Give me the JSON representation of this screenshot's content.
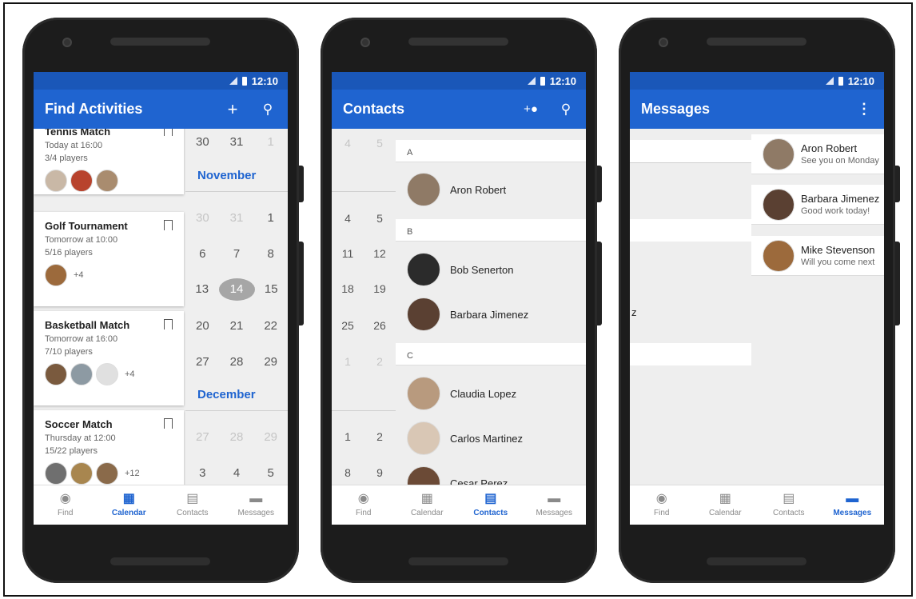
{
  "status": {
    "time": "12:10"
  },
  "nav": [
    "Find",
    "Calendar",
    "Contacts",
    "Messages"
  ],
  "icons": {
    "find": "compass-icon",
    "calendar": "calendar-icon",
    "contacts": "contacts-icon",
    "messages": "message-icon"
  },
  "colors": {
    "primary": "#1f64d0",
    "status": "#1a57b8"
  },
  "find": {
    "title": "Find Activities",
    "cards": [
      {
        "title": "Tennis Match",
        "time": "Today at 16:00",
        "players": "3/4 players",
        "more": ""
      },
      {
        "title": "Golf Tournament",
        "time": "Tomorrow at 10:00",
        "players": "5/16 players",
        "more": "+4"
      },
      {
        "title": "Basketball Match",
        "time": "Tomorrow at 16:00",
        "players": "7/10 players",
        "more": "+4"
      },
      {
        "title": "Soccer Match",
        "time": "Thursday at 12:00",
        "players": "15/22 players",
        "more": "+12"
      }
    ],
    "calendar": {
      "rows": [
        [
          "30",
          "31",
          "1"
        ],
        [
          "30",
          "31",
          "1"
        ],
        [
          "6",
          "7",
          "8"
        ],
        [
          "13",
          "14",
          "15"
        ],
        [
          "20",
          "21",
          "22"
        ],
        [
          "27",
          "28",
          "29"
        ],
        [
          "27",
          "28",
          "29"
        ],
        [
          "3",
          "4",
          "5"
        ]
      ],
      "months": [
        "November",
        "December"
      ]
    }
  },
  "contacts": {
    "title": "Contacts",
    "sections": [
      "A",
      "B",
      "C"
    ],
    "people": [
      "Aron Robert",
      "Bob Senerton",
      "Barbara Jimenez",
      "Claudia Lopez",
      "Carlos Martinez",
      "Cesar Perez"
    ],
    "left": [
      [
        "4",
        "5"
      ],
      [
        "4",
        "5"
      ],
      [
        "11",
        "12"
      ],
      [
        "18",
        "19"
      ],
      [
        "25",
        "26"
      ],
      [
        "1",
        "2"
      ],
      [
        "1",
        "2"
      ],
      [
        "8",
        "9"
      ]
    ]
  },
  "messages": {
    "title": "Messages",
    "items": [
      {
        "name": "Aron Robert",
        "preview": "See you on Monday"
      },
      {
        "name": "Barbara Jimenez",
        "preview": "Good work today!"
      },
      {
        "name": "Mike Stevenson",
        "preview": "Will you come next"
      }
    ],
    "ghost": "z"
  }
}
